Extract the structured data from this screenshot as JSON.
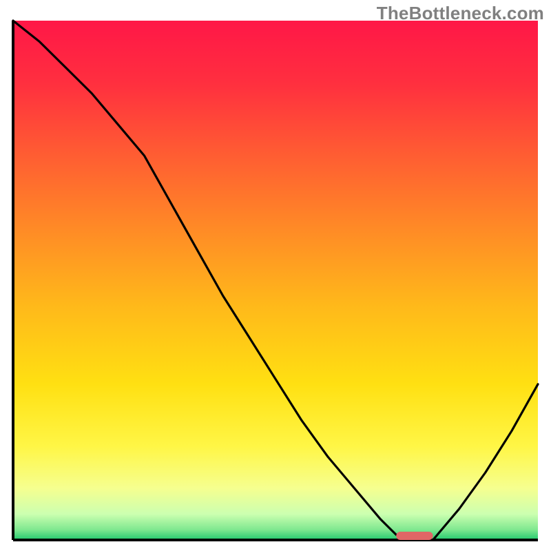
{
  "watermark": "TheBottleneck.com",
  "chart_data": {
    "type": "line",
    "title": "",
    "xlabel": "",
    "ylabel": "",
    "xlim": [
      0,
      100
    ],
    "ylim": [
      0,
      100
    ],
    "x": [
      0,
      5,
      10,
      15,
      20,
      25,
      30,
      35,
      40,
      45,
      50,
      55,
      60,
      65,
      70,
      73,
      76,
      80,
      85,
      90,
      95,
      100
    ],
    "y": [
      100,
      96,
      91,
      86,
      80,
      74,
      65,
      56,
      47,
      39,
      31,
      23,
      16,
      10,
      4,
      1,
      0,
      0,
      6,
      13,
      21,
      30
    ],
    "marker": {
      "x_start": 73,
      "x_end": 80,
      "y": 0.8
    },
    "gradient_stops": [
      {
        "offset": 0.0,
        "color": "#ff1747"
      },
      {
        "offset": 0.12,
        "color": "#ff2f3f"
      },
      {
        "offset": 0.25,
        "color": "#ff5a33"
      },
      {
        "offset": 0.4,
        "color": "#ff8a26"
      },
      {
        "offset": 0.55,
        "color": "#ffb91a"
      },
      {
        "offset": 0.7,
        "color": "#ffe012"
      },
      {
        "offset": 0.82,
        "color": "#fff646"
      },
      {
        "offset": 0.9,
        "color": "#f6ff8f"
      },
      {
        "offset": 0.95,
        "color": "#ccffb0"
      },
      {
        "offset": 0.98,
        "color": "#7fe890"
      },
      {
        "offset": 1.0,
        "color": "#21c96e"
      }
    ],
    "axis_color": "#000000",
    "curve_color": "#000000",
    "marker_color": "#e06666"
  }
}
